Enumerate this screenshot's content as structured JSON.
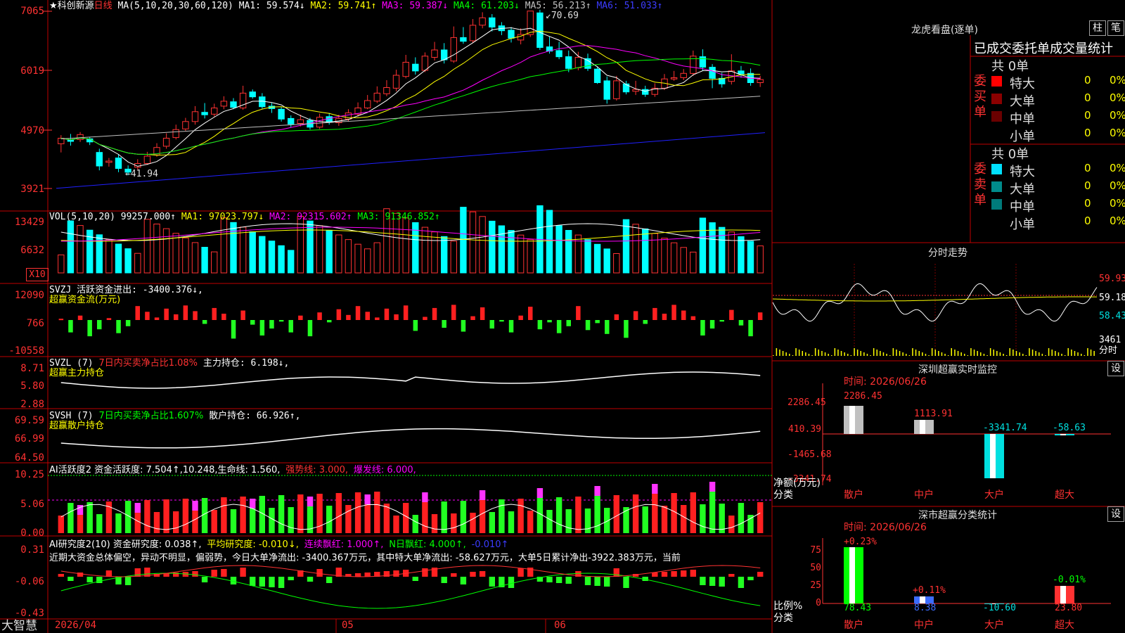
{
  "main": {
    "title": "★科创新源",
    "period": "日线",
    "ma_text": "MA(5,10,20,30,60,120)",
    "ma1": "MA1: 59.574↓",
    "ma2": "MA2: 59.741↑",
    "ma3": "MA3: 59.387↓",
    "ma4": "MA4: 61.203↓",
    "ma5": "MA5: 56.213↑",
    "ma6": "MA6: 51.033↑",
    "high_label": "70.69",
    "low_label": "41.94",
    "axis": [
      "7065",
      "6019",
      "4970",
      "3921"
    ]
  },
  "vol": {
    "label": "VOL(5,10,20) 99257.000↑",
    "ma1": "MA1: 97023.797↓",
    "ma2": "MA2: 92315.602↑",
    "ma3": "MA3: 91346.852↑",
    "axis": [
      "13429",
      "6632"
    ],
    "unit": "X10"
  },
  "svzj": {
    "label": "SVZJ  活跃资金进出: -3400.376↓,",
    "sub": "超赢资金流(万元)",
    "axis": [
      "12090",
      "766",
      "-10558"
    ]
  },
  "svzl": {
    "label": "SVZL (7)",
    "pct": "7日内买卖净占比1.08%",
    "hold": "主力持仓: 6.198↓,",
    "sub": "超赢主力持仓",
    "axis": [
      "8.71",
      "5.80",
      "2.88"
    ]
  },
  "svsh": {
    "label": "SVSH (7)",
    "pct": "7日内买卖净占比1.607%",
    "hold": "散户持仓: 66.926↑,",
    "sub": "超赢散户持仓",
    "axis": [
      "69.59",
      "66.99",
      "64.50"
    ]
  },
  "ai": {
    "label": "AI活跃度2 资金活跃度: 7.504↑,10.248,生命线: 1.560,",
    "strong": "强势线: 3.000,",
    "burst": "爆发线: 6.000,",
    "axis": [
      "10.25",
      "5.06",
      "0.00"
    ]
  },
  "research": {
    "label": "AI研究度2(10) 资金研究度: 0.038↑,",
    "avg": "平均研究度: -0.010↓,",
    "red1": "连续飘红: 1.000↑,",
    "red2": "N日飘红: 4.000↑,",
    "last": "-0.010↑",
    "text": "近期大资金总体偏空，异动不明显，偏弱势，今日大单净流出: -3400.367万元，其中特大单净流出: -58.627万元，大单5日累计净出-3922.383万元，当前",
    "axis": [
      "0.31",
      "-0.06",
      "-0.43"
    ]
  },
  "bottom": {
    "brand": "大智慧",
    "date": "2026/04",
    "months": [
      "05",
      "06"
    ]
  },
  "right": {
    "dragon_title": "龙虎看盘(逐单)",
    "btn_col": "柱",
    "btn_pen": "笔",
    "header": "已成交委托单成交量统计",
    "buy_label": "委买单",
    "sell_label": "委卖单",
    "buy_total": "共 0单",
    "sell_total": "共 0单",
    "buy_rows": [
      {
        "name": "特大",
        "count": "0",
        "pct": "0%",
        "color": "#ff0000"
      },
      {
        "name": "大单",
        "count": "0",
        "pct": "0%",
        "color": "#8b0000"
      },
      {
        "name": "中单",
        "count": "0",
        "pct": "0%",
        "color": "#6b0000"
      },
      {
        "name": "小单",
        "count": "0",
        "pct": "0%",
        "color": ""
      }
    ],
    "sell_rows": [
      {
        "name": "特大",
        "count": "0",
        "pct": "0%",
        "color": "#00e0ff"
      },
      {
        "name": "大单",
        "count": "0",
        "pct": "0%",
        "color": "#008b8b"
      },
      {
        "name": "中单",
        "count": "0",
        "pct": "0%",
        "color": "#007b7b"
      },
      {
        "name": "小单",
        "count": "0",
        "pct": "0%",
        "color": ""
      }
    ],
    "fenshi_title": "分时走势",
    "fenshi_axis": [
      "59.93",
      "59.18",
      "58.43"
    ],
    "fenshi_vol": "3461",
    "fenshi_vol_unit": "分时",
    "sz_monitor_title": "深圳超赢实时监控",
    "set_label": "设",
    "time_label": "时间: 2026/06/26",
    "monitor_axis": [
      "2286.45",
      "410.39",
      "-1465.68",
      "-3341.74"
    ],
    "monitor_values": [
      "2286.45",
      "1113.91",
      "-3341.74",
      "-58.63"
    ],
    "monitor_ylabel": "净额(万元)",
    "monitor_xlabel": "分类",
    "categories": [
      "散户",
      "中户",
      "大户",
      "超大"
    ],
    "sz_stat_title": "深市超赢分类统计",
    "stat_axis": [
      "75",
      "50",
      "25",
      "0"
    ],
    "stat_top": [
      "+0.23%",
      "+0.11%",
      "",
      "-0.01%"
    ],
    "stat_values": [
      "78.43",
      "8.38",
      "-10.60",
      "23.80"
    ],
    "stat_ylabel": "比例%",
    "stat_xlabel": "分类"
  },
  "chart_data": {
    "type": "candlestick",
    "candles": [
      [
        49.2,
        50.1,
        47.8,
        50.6
      ],
      [
        49.8,
        49.6,
        48.9,
        50.8
      ],
      [
        49.9,
        50.7,
        49.5,
        51.1
      ],
      [
        50.0,
        49.5,
        49.0,
        50.3
      ],
      [
        47.8,
        45.6,
        44.9,
        48.4
      ],
      [
        46.2,
        46.4,
        45.5,
        46.9
      ],
      [
        46.9,
        45.2,
        44.6,
        47.5
      ],
      [
        45.1,
        44.6,
        44.1,
        45.7
      ],
      [
        45.4,
        46.0,
        45.0,
        46.7
      ],
      [
        46.0,
        47.2,
        45.8,
        47.9
      ],
      [
        47.4,
        48.6,
        47.1,
        49.3
      ],
      [
        48.8,
        50.1,
        48.4,
        50.9
      ],
      [
        50.2,
        51.5,
        49.9,
        52.3
      ],
      [
        51.6,
        52.8,
        51.3,
        53.4
      ],
      [
        52.8,
        54.4,
        52.3,
        55.3
      ],
      [
        54.3,
        53.9,
        53.3,
        55.8
      ],
      [
        54.0,
        55.0,
        53.6,
        55.7
      ],
      [
        55.3,
        56.1,
        54.8,
        56.9
      ],
      [
        56.0,
        55.1,
        54.8,
        56.6
      ],
      [
        55.0,
        57.4,
        54.7,
        58.6
      ],
      [
        57.6,
        56.8,
        56.5,
        58.0
      ],
      [
        56.8,
        55.2,
        54.9,
        57.4
      ],
      [
        55.3,
        54.9,
        54.2,
        55.8
      ],
      [
        54.8,
        53.2,
        52.8,
        55.2
      ],
      [
        53.3,
        52.4,
        51.9,
        53.8
      ],
      [
        52.5,
        53.1,
        52.0,
        53.9
      ],
      [
        53.0,
        51.9,
        51.5,
        53.4
      ],
      [
        51.9,
        53.5,
        51.6,
        54.1
      ],
      [
        53.6,
        52.7,
        52.3,
        54.2
      ],
      [
        52.6,
        53.3,
        52.1,
        53.9
      ],
      [
        53.2,
        54.2,
        52.8,
        54.8
      ],
      [
        54.0,
        55.0,
        53.6,
        55.9
      ],
      [
        55.0,
        56.2,
        54.8,
        57.1
      ],
      [
        56.1,
        57.4,
        55.8,
        58.5
      ],
      [
        57.3,
        58.3,
        56.9,
        59.5
      ],
      [
        58.2,
        60.3,
        57.7,
        61.2
      ],
      [
        60.1,
        62.4,
        59.8,
        63.6
      ],
      [
        62.1,
        61.0,
        60.4,
        63.2
      ],
      [
        61.1,
        63.4,
        60.8,
        64.0
      ],
      [
        63.2,
        64.4,
        62.7,
        65.7
      ],
      [
        64.4,
        62.8,
        62.2,
        65.5
      ],
      [
        62.6,
        66.4,
        62.3,
        68.2
      ],
      [
        66.4,
        65.8,
        65.4,
        68.1
      ],
      [
        65.9,
        68.4,
        65.5,
        69.4
      ],
      [
        68.4,
        69.6,
        67.9,
        70.5
      ],
      [
        69.6,
        68.1,
        67.4,
        70.2
      ],
      [
        68.3,
        67.5,
        66.8,
        68.9
      ],
      [
        67.6,
        66.3,
        65.6,
        68.1
      ],
      [
        66.0,
        66.9,
        65.3,
        67.9
      ],
      [
        66.9,
        70.7,
        66.5,
        70.7
      ],
      [
        70.4,
        64.8,
        64.4,
        70.9
      ],
      [
        64.9,
        64.2,
        63.8,
        66.6
      ],
      [
        64.3,
        63.3,
        62.9,
        65.7
      ],
      [
        63.3,
        61.4,
        60.8,
        64.3
      ],
      [
        61.5,
        63.2,
        61.1,
        64.1
      ],
      [
        63.0,
        61.4,
        61.0,
        63.8
      ],
      [
        61.3,
        59.1,
        58.9,
        61.7
      ],
      [
        59.4,
        56.4,
        55.7,
        60.1
      ],
      [
        56.5,
        59.4,
        56.2,
        60.2
      ],
      [
        58.9,
        57.6,
        57.2,
        59.4
      ],
      [
        57.7,
        58.0,
        57.1,
        59.4
      ],
      [
        58.0,
        57.2,
        56.8,
        58.6
      ],
      [
        57.2,
        58.2,
        56.8,
        59.0
      ],
      [
        58.2,
        59.7,
        57.9,
        60.5
      ],
      [
        59.7,
        59.9,
        59.4,
        61.0
      ],
      [
        59.9,
        60.6,
        59.5,
        61.3
      ],
      [
        60.6,
        63.4,
        60.2,
        64.3
      ],
      [
        63.3,
        61.6,
        61.0,
        64.5
      ],
      [
        61.6,
        59.8,
        58.2,
        62.1
      ],
      [
        59.8,
        58.9,
        58.3,
        60.7
      ],
      [
        59.3,
        61.0,
        58.8,
        63.7
      ],
      [
        61.0,
        60.5,
        59.9,
        61.8
      ],
      [
        60.6,
        59.1,
        58.6,
        61.4
      ],
      [
        59.1,
        59.6,
        58.4,
        60.2
      ]
    ]
  }
}
